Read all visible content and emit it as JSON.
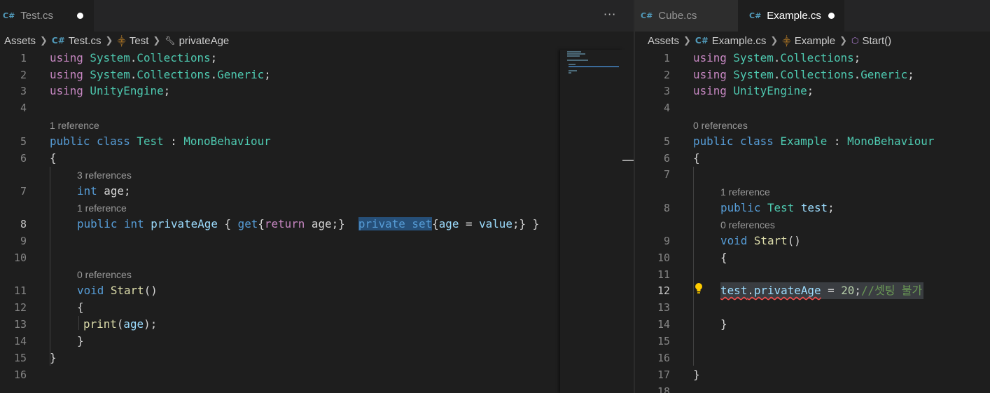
{
  "left": {
    "tabs": [
      {
        "label": "Test.cs"
      }
    ],
    "more_label": "···",
    "breadcrumb": [
      "Assets",
      "Test.cs",
      "Test",
      "privateAge"
    ],
    "lens": {
      "l5": "1 reference",
      "l7": "3 references",
      "l8": "1 reference",
      "l11": "0 references"
    },
    "lines": {
      "1": [
        "using",
        " System",
        ".",
        "Collections",
        ";"
      ],
      "2": [
        "using",
        " System",
        ".",
        "Collections",
        ".",
        "Generic",
        ";"
      ],
      "3": [
        "using",
        " UnityEngine",
        ";"
      ],
      "5": [
        "public",
        " class",
        " Test",
        " : ",
        "MonoBehaviour"
      ],
      "6": "{",
      "7": [
        "int",
        " age;"
      ],
      "8": [
        "public",
        " int",
        " privateAge",
        " { ",
        "get",
        "{",
        "return",
        " age;}",
        "  ",
        "private set",
        "{",
        "age",
        " = ",
        "value",
        ";} }"
      ],
      "11": [
        "void",
        " Start",
        "()"
      ],
      "12": "{",
      "13": [
        "print",
        "(",
        "age",
        ");"
      ],
      "14": "}",
      "15": "}"
    },
    "line_numbers": [
      "1",
      "2",
      "3",
      "4",
      "5",
      "6",
      "7",
      "8",
      "9",
      "10",
      "11",
      "12",
      "13",
      "14",
      "15",
      "16"
    ]
  },
  "right": {
    "tabs": [
      {
        "label": "Cube.cs"
      },
      {
        "label": "Example.cs"
      }
    ],
    "breadcrumb": [
      "Assets",
      "Example.cs",
      "Example",
      "Start()"
    ],
    "lens": {
      "l5": "0 references",
      "l8": "1 reference",
      "l9": "0 references"
    },
    "lines": {
      "1": [
        "using",
        " System",
        ".",
        "Collections",
        ";"
      ],
      "2": [
        "using",
        " System",
        ".",
        "Collections",
        ".",
        "Generic",
        ";"
      ],
      "3": [
        "using",
        " UnityEngine",
        ";"
      ],
      "5": [
        "public",
        " class",
        " Example",
        " : ",
        "MonoBehaviour"
      ],
      "6": "{",
      "8": [
        "public",
        " Test",
        " test",
        ";"
      ],
      "9": [
        "void",
        " Start",
        "()"
      ],
      "10": "{",
      "12": [
        "test",
        ".",
        "privateAge",
        " = ",
        "20",
        ";",
        "//셋팅 불가"
      ],
      "14": "}",
      "17": "}"
    },
    "line_numbers": [
      "1",
      "2",
      "3",
      "4",
      "5",
      "6",
      "7",
      "8",
      "9",
      "10",
      "11",
      "12",
      "13",
      "14",
      "15",
      "16",
      "17",
      "18"
    ]
  },
  "icons": {
    "cs": "C#",
    "class": "class-icon",
    "property": "wrench-icon",
    "method": "method-cube-icon",
    "lightbulb": "lightbulb-icon"
  },
  "colors": {
    "keyword": "#569cd6",
    "control": "#c586c0",
    "type": "#4ec9b0",
    "function": "#dcdcaa",
    "variable": "#9cdcfe",
    "number": "#b5cea8",
    "comment": "#6a9955",
    "selection": "#264f78"
  }
}
